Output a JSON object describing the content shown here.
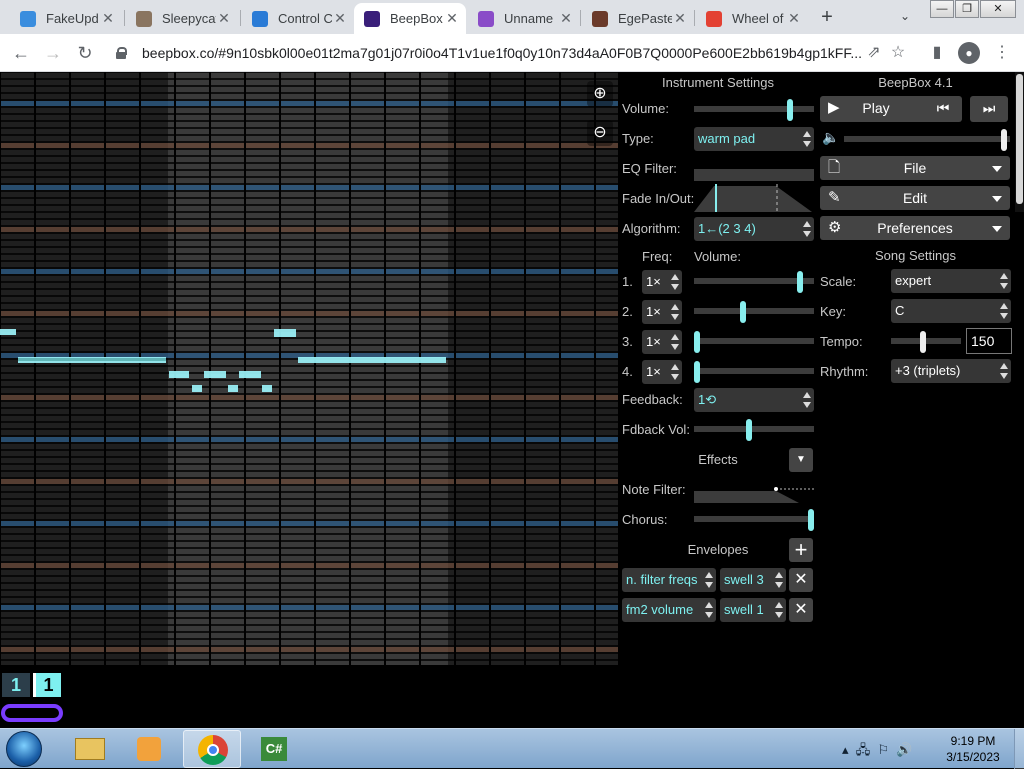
{
  "browser": {
    "tabs": [
      {
        "title": "FakeUpd",
        "color": "#3a8dde",
        "active": false
      },
      {
        "title": "Sleepycat",
        "color": "#8a7560",
        "active": false
      },
      {
        "title": "Control C",
        "color": "#2a7bd6",
        "active": false
      },
      {
        "title": "BeepBox",
        "color": "#3a1f7a",
        "active": true
      },
      {
        "title": "Unname",
        "color": "#8a4cc8",
        "active": false
      },
      {
        "title": "EgePaste",
        "color": "#6b3a2a",
        "active": false
      },
      {
        "title": "Wheel of",
        "color": "#e34133",
        "active": false
      }
    ],
    "new_tab": "+",
    "url": "beepbox.co/#9n10sbk0l00e01t2ma7g01j07r0i0o4T1v1ue1f0q0y10n73d4aA0F0B7Q0000Pe600E2bb619b4gp1kFF..."
  },
  "instrument": {
    "header": "Instrument Settings",
    "volume_label": "Volume:",
    "volume": 0.82,
    "type_label": "Type:",
    "type_value": "warm pad",
    "eq_label": "EQ Filter:",
    "fade_label": "Fade In/Out:",
    "algorithm_label": "Algorithm:",
    "algorithm_value": "1←(2 3 4)",
    "freq_header": "Freq:",
    "vol_header": "Volume:",
    "operators": [
      {
        "num": "1.",
        "freq": "1×",
        "volume": 0.9
      },
      {
        "num": "2.",
        "freq": "1×",
        "volume": 0.4
      },
      {
        "num": "3.",
        "freq": "1×",
        "volume": 0.0
      },
      {
        "num": "4.",
        "freq": "1×",
        "volume": 0.0
      }
    ],
    "feedback_label": "Feedback:",
    "feedback_value": "1⟲",
    "fdback_vol_label": "Fdback Vol:",
    "fdback_vol": 0.46,
    "effects_label": "Effects",
    "note_filter_label": "Note Filter:",
    "chorus_label": "Chorus:",
    "chorus": 1.0,
    "envelopes_label": "Envelopes",
    "envelopes": [
      {
        "target": "n. filter freqs",
        "shape": "swell 3"
      },
      {
        "target": "fm2 volume",
        "shape": "swell 1"
      }
    ]
  },
  "song": {
    "title": "BeepBox 4.1",
    "play_label": "Play",
    "file_label": "File",
    "edit_label": "Edit",
    "preferences_label": "Preferences",
    "master_volume": 0.98,
    "header": "Song Settings",
    "scale_label": "Scale:",
    "scale_value": "expert",
    "key_label": "Key:",
    "key_value": "C",
    "tempo_label": "Tempo:",
    "tempo_value": "150",
    "tempo_slider": 0.45,
    "rhythm_label": "Rhythm:",
    "rhythm_value": "+3 (triplets)"
  },
  "bottom": {
    "channel_a": "1",
    "channel_b": "1"
  },
  "taskbar": {
    "time": "9:19 PM",
    "date": "3/15/2023"
  },
  "colors": {
    "accent_cyan": "#7ef0f0",
    "note": "#9ff8ff",
    "loop": "#7a3cff"
  }
}
